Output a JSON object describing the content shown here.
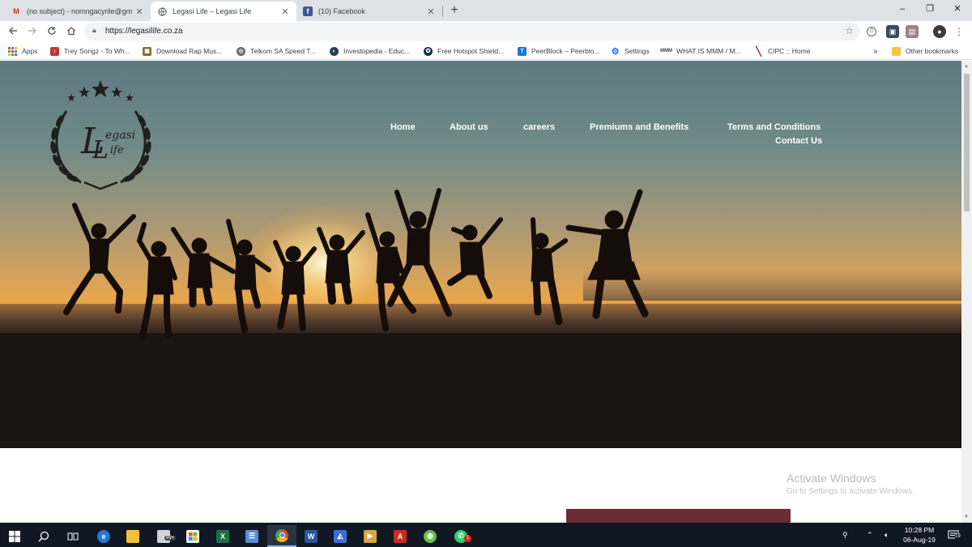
{
  "browser": {
    "tabs": [
      {
        "title": "(no subject) - nomngacyrile@gm",
        "icon": "gmail-icon",
        "active": false
      },
      {
        "title": "Legasi Life – Legasi Life",
        "icon": "globe-icon",
        "active": true
      },
      {
        "title": "(10) Facebook",
        "icon": "facebook-icon",
        "active": false
      }
    ],
    "new_tab": "+",
    "window_controls": {
      "minimize": "–",
      "restore": "❐",
      "close": "✕"
    },
    "url": "https://legasilife.co.za",
    "bookmarks": [
      {
        "label": "Apps",
        "icon": "apps-grid-icon",
        "color": "#e8453c"
      },
      {
        "label": "Trey Songz - To Wh...",
        "icon": "music-icon",
        "color": "#c0392b"
      },
      {
        "label": "Download Rap Mus...",
        "icon": "rap-site-icon",
        "color": "#8a6d2b"
      },
      {
        "label": "Telkom SA Speed T...",
        "icon": "globe-icon",
        "color": "#5f6368"
      },
      {
        "label": "Investopedia - Educ...",
        "icon": "investopedia-icon",
        "color": "#2c3e50"
      },
      {
        "label": "Free Hotspot Shield...",
        "icon": "shield-icon",
        "color": "#1b2a4a"
      },
      {
        "label": "PeerBlock – Peerblo...",
        "icon": "peerblock-icon",
        "color": "#1a73e8"
      },
      {
        "label": "Settings",
        "icon": "gear-icon",
        "color": "#1a73e8"
      },
      {
        "label": "WHAT IS MMM / M...",
        "icon": "mmm-icon",
        "color": "#444"
      },
      {
        "label": "CIPC :: Home",
        "icon": "cipc-icon",
        "color": "#8e1a5c"
      }
    ],
    "bookmarks_overflow": "»",
    "other_bookmarks": "Other bookmarks"
  },
  "site": {
    "logo_text": "Legasi Life",
    "nav": [
      {
        "label": "Home"
      },
      {
        "label": "About us"
      },
      {
        "label": "careers"
      },
      {
        "label": "Premiums and Benefits"
      },
      {
        "label": "Terms and Conditions"
      },
      {
        "label": "Contact Us"
      }
    ]
  },
  "watermark": {
    "title": "Activate Windows",
    "subtitle": "Go to Settings to activate Windows."
  },
  "taskbar": {
    "items": [
      {
        "name": "start-button",
        "icon": "windows-icon"
      },
      {
        "name": "search-button",
        "icon": "search-icon"
      },
      {
        "name": "task-view-button",
        "icon": "task-view-icon"
      },
      {
        "name": "edge-app",
        "icon": "edge-icon",
        "color": "#1f7ad0",
        "glyph": "e"
      },
      {
        "name": "file-explorer-app",
        "icon": "folder-icon",
        "color": "#f3c03a",
        "glyph": ""
      },
      {
        "name": "vpn-app",
        "icon": "vpn-icon",
        "color": "#cfd4da",
        "glyph": "",
        "badge": "99+"
      },
      {
        "name": "store-app",
        "icon": "store-icon",
        "color": "#f0f0f0",
        "glyph": ""
      },
      {
        "name": "excel-app",
        "icon": "excel-icon",
        "color": "#1d7044",
        "glyph": "X"
      },
      {
        "name": "network-app",
        "icon": "network-icon",
        "color": "#5a8ed6",
        "glyph": ""
      },
      {
        "name": "chrome-app",
        "icon": "chrome-icon",
        "color": "#4285f4",
        "glyph": "",
        "active": true
      },
      {
        "name": "word-app",
        "icon": "word-icon",
        "color": "#2b579a",
        "glyph": "W"
      },
      {
        "name": "media-app",
        "icon": "media-icon",
        "color": "#3b6ed6",
        "glyph": ""
      },
      {
        "name": "video-app",
        "icon": "video-icon",
        "color": "#d9a441",
        "glyph": "▶"
      },
      {
        "name": "acrobat-app",
        "icon": "acrobat-icon",
        "color": "#d2281e",
        "glyph": "A"
      },
      {
        "name": "globe-app",
        "icon": "globe-icon",
        "color": "#6cbf47",
        "glyph": ""
      },
      {
        "name": "whatsapp-app",
        "icon": "whatsapp-icon",
        "color": "#25d366",
        "glyph": "",
        "badge": "1"
      }
    ],
    "clock_time": "10:28 PM",
    "clock_date": "06-Aug-19",
    "notifications_badge": "19"
  }
}
